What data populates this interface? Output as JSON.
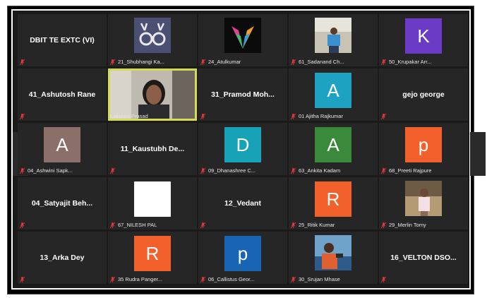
{
  "colors": {
    "background": "#1a1a1a",
    "tile": "#262626",
    "active_border": "#d4dc4a",
    "muted_mic": "#e0353a"
  },
  "tiles": [
    {
      "type": "name",
      "big": "DBIT TE EXTC (VI)",
      "label": ""
    },
    {
      "type": "photo",
      "photo": "deer-logo",
      "label": "21_Shubhangi Ka..."
    },
    {
      "type": "photo",
      "photo": "colorful-wings",
      "label": "24_Atulkumar"
    },
    {
      "type": "photo",
      "photo": "person-outdoor",
      "label": "61_Sadanand Ch..."
    },
    {
      "type": "avatar",
      "letter": "K",
      "color": "#6a3bc4",
      "label": "50_Krupakar Arr..."
    },
    {
      "type": "name",
      "big": "41_Ashutosh Rane",
      "label": ""
    },
    {
      "type": "video",
      "label": "Lakshmi Prasad"
    },
    {
      "type": "name",
      "big": "31_Pramod  Moh...",
      "label": ""
    },
    {
      "type": "avatar",
      "letter": "A",
      "color": "#1da2c2",
      "label": "01 Ajitha Rajkumar"
    },
    {
      "type": "name",
      "big": "gejo george",
      "label": ""
    },
    {
      "type": "avatar",
      "letter": "A",
      "color": "#8a7068",
      "label": "04_Ashwini Sapk..."
    },
    {
      "type": "name",
      "big": "11_Kaustubh  De...",
      "label": ""
    },
    {
      "type": "avatar",
      "letter": "D",
      "color": "#17a2b8",
      "label": "09_Dhanashree C..."
    },
    {
      "type": "avatar",
      "letter": "A",
      "color": "#3b8a3b",
      "label": "63_Ankita Kadam"
    },
    {
      "type": "avatar",
      "letter": "p",
      "color": "#f2602b",
      "label": "68_Preeti Rajpure"
    },
    {
      "type": "name",
      "big": "04_Satyajit  Beh...",
      "label": ""
    },
    {
      "type": "white",
      "label": "67_NILESH PAL"
    },
    {
      "type": "name",
      "big": "12_Vedant",
      "label": ""
    },
    {
      "type": "avatar",
      "letter": "R",
      "color": "#f2602b",
      "label": "25_Ritik Kumar"
    },
    {
      "type": "photo",
      "photo": "girl-photo",
      "label": "29_Merlin Tomy"
    },
    {
      "type": "name",
      "big": "13_Arka Dey",
      "label": ""
    },
    {
      "type": "avatar",
      "letter": "R",
      "color": "#f2602b",
      "label": "35 Rudra Panger..."
    },
    {
      "type": "avatar",
      "letter": "p",
      "color": "#1a64b4",
      "label": "06_Callistus Geor..."
    },
    {
      "type": "photo",
      "photo": "man-outdoor",
      "label": "30_Srujan Mhase"
    },
    {
      "type": "name",
      "big": "16_VELTON  DSO...",
      "label": ""
    }
  ]
}
